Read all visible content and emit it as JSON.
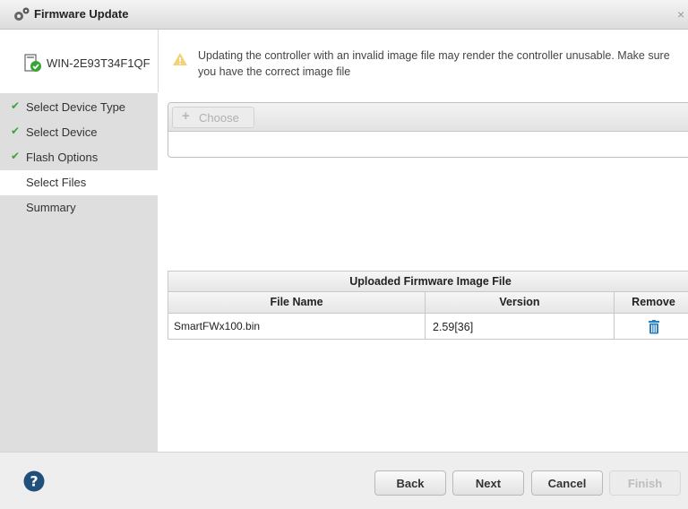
{
  "window": {
    "title": "Firmware Update",
    "close_glyph": "×",
    "title_icon": "gears-icon",
    "close_icon": "close-icon"
  },
  "device": {
    "name": "WIN-2E93T34F1QF",
    "icon": "device-check-icon"
  },
  "warning": {
    "icon": "warning-triangle-icon",
    "text": "Updating the controller with an invalid image file may render the controller unusable. Make sure you have the correct image file"
  },
  "steps": [
    {
      "label": "Select Device Type",
      "done": true
    },
    {
      "label": "Select Device",
      "done": true
    },
    {
      "label": "Flash Options",
      "done": true
    },
    {
      "label": "Select Files",
      "done": false,
      "active": true
    },
    {
      "label": "Summary",
      "done": false
    }
  ],
  "upload": {
    "choose_label": "Choose",
    "choose_icon": "plus-icon"
  },
  "firmware_table": {
    "caption": "Uploaded Firmware Image File",
    "columns": [
      "File Name",
      "Version",
      "Remove"
    ],
    "rows": [
      {
        "file_name": "SmartFWx100.bin",
        "version": "2.59[36]",
        "remove_icon": "trash-icon"
      }
    ]
  },
  "footer": {
    "help_icon": "help-icon",
    "back_label": "Back",
    "next_label": "Next",
    "cancel_label": "Cancel",
    "finish_label": "Finish"
  },
  "colors": {
    "check": "#3aa335",
    "sidebar_bg": "#dedede",
    "help_icon": "#1f4f7a",
    "trash_icon": "#2a7fc0"
  }
}
